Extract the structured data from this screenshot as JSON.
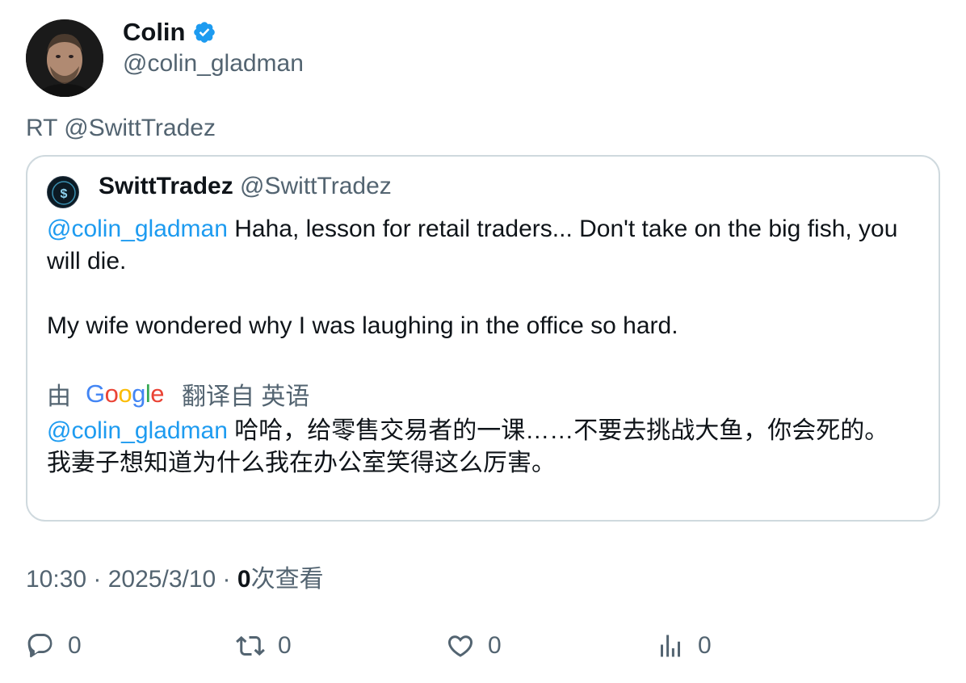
{
  "author": {
    "name": "Colin",
    "handle": "@colin_gladman",
    "verified_icon": "verified-badge-icon"
  },
  "retweet_line": "RT @SwittTradez",
  "quote": {
    "name": "SwittTradez",
    "handle": "@SwittTradez",
    "mention": "@colin_gladman",
    "text_line1": " Haha, lesson for retail traders... Don't take on the big fish, you will die.",
    "text_para2": "My wife wondered why I was laughing in the office so hard.",
    "translate_prefix": "由",
    "translate_suffix": "翻译自 英语",
    "translated_mention": "@colin_gladman",
    "translated_text": " 哈哈，给零售交易者的一课……不要去挑战大鱼，你会死的。 我妻子想知道为什么我在办公室笑得这么厉害。"
  },
  "meta": {
    "time": "10:30",
    "sep1": " · ",
    "date": "2025/3/10",
    "sep2": " · ",
    "views_count": "0",
    "views_label": "次查看"
  },
  "actions": {
    "reply_count": "0",
    "retweet_count": "0",
    "like_count": "0",
    "views_count": "0"
  },
  "colors": {
    "accent": "#1d9bf0",
    "muted": "#536471",
    "border": "#cfd9de",
    "text": "#0f1419"
  }
}
